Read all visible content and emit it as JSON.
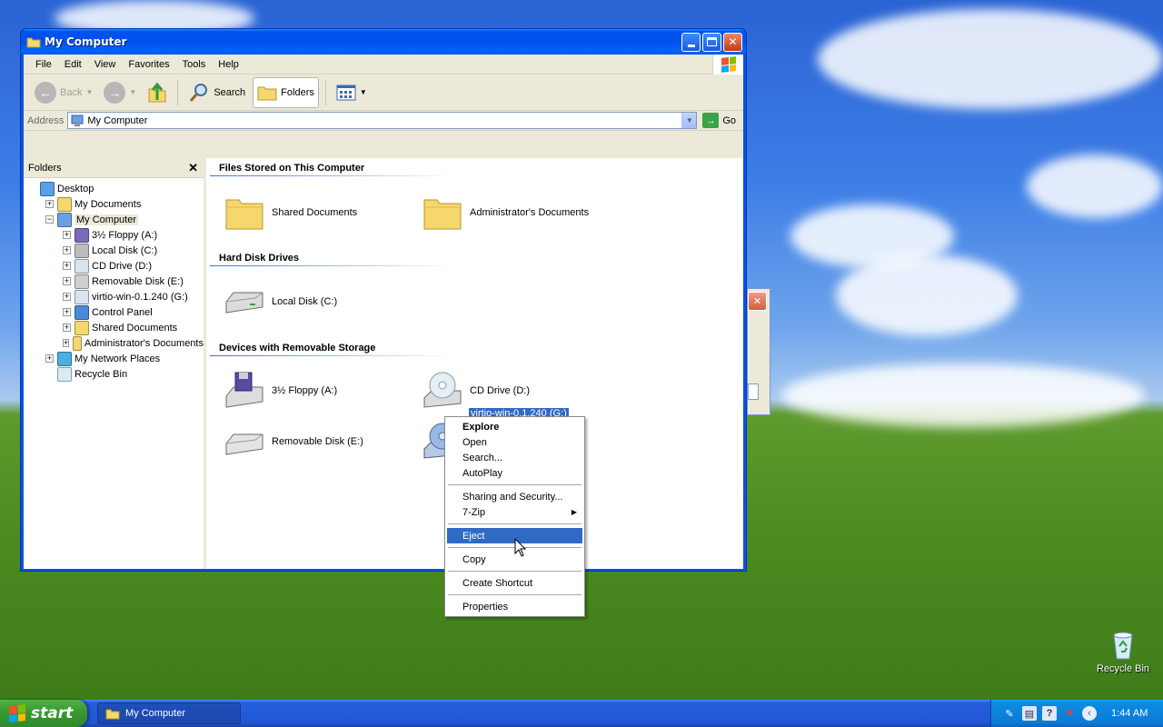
{
  "window": {
    "title": "My Computer",
    "menu": [
      "File",
      "Edit",
      "View",
      "Favorites",
      "Tools",
      "Help"
    ],
    "toolbar": {
      "back": "Back",
      "search": "Search",
      "folders": "Folders"
    },
    "address": {
      "label": "Address",
      "value": "My Computer",
      "go": "Go"
    }
  },
  "folders_pane": {
    "title": "Folders",
    "tree": [
      {
        "label": "Desktop",
        "level": 0,
        "expander": "",
        "icon": "desktop-icon"
      },
      {
        "label": "My Documents",
        "level": 1,
        "expander": "+",
        "icon": "my-documents-icon"
      },
      {
        "label": "My Computer",
        "level": 1,
        "expander": "−",
        "icon": "my-computer-icon",
        "selected": true
      },
      {
        "label": "3½ Floppy (A:)",
        "level": 2,
        "expander": "+",
        "icon": "floppy-icon"
      },
      {
        "label": "Local Disk (C:)",
        "level": 2,
        "expander": "+",
        "icon": "hard-disk-icon"
      },
      {
        "label": "CD Drive (D:)",
        "level": 2,
        "expander": "+",
        "icon": "cd-drive-icon"
      },
      {
        "label": "Removable Disk (E:)",
        "level": 2,
        "expander": "+",
        "icon": "removable-disk-icon"
      },
      {
        "label": "virtio-win-0.1.240 (G:)",
        "level": 2,
        "expander": "+",
        "icon": "cd-drive-icon"
      },
      {
        "label": "Control Panel",
        "level": 2,
        "expander": "+",
        "icon": "control-panel-icon"
      },
      {
        "label": "Shared Documents",
        "level": 2,
        "expander": "+",
        "icon": "folder-icon"
      },
      {
        "label": "Administrator's Documents",
        "level": 2,
        "expander": "+",
        "icon": "folder-icon"
      },
      {
        "label": "My Network Places",
        "level": 1,
        "expander": "+",
        "icon": "network-places-icon"
      },
      {
        "label": "Recycle Bin",
        "level": 1,
        "expander": "",
        "icon": "recycle-bin-icon"
      }
    ]
  },
  "content": {
    "groups": [
      {
        "header": "Files Stored on This Computer",
        "items": [
          "Shared Documents",
          "Administrator's Documents"
        ]
      },
      {
        "header": "Hard Disk Drives",
        "items": [
          "Local Disk (C:)"
        ]
      },
      {
        "header": "Devices with Removable Storage",
        "items": [
          "3½ Floppy (A:)",
          "CD Drive (D:)",
          "Removable Disk (E:)",
          "virtio-win-0.1.240 (G:)"
        ]
      }
    ]
  },
  "context_menu": {
    "items": [
      "Explore",
      "Open",
      "Search...",
      "AutoPlay",
      "Sharing and Security...",
      "7-Zip",
      "Eject",
      "Copy",
      "Create Shortcut",
      "Properties"
    ],
    "highlighted": "Eject"
  },
  "desktop": {
    "recycle_bin_label": "Recycle Bin"
  },
  "taskbar": {
    "start_label": "start",
    "task_label": "My Computer",
    "clock": "1:44 AM"
  },
  "colors": {
    "selection": "#316ac5",
    "title_blue": "#0054e3",
    "start_green": "#3a9a33"
  }
}
